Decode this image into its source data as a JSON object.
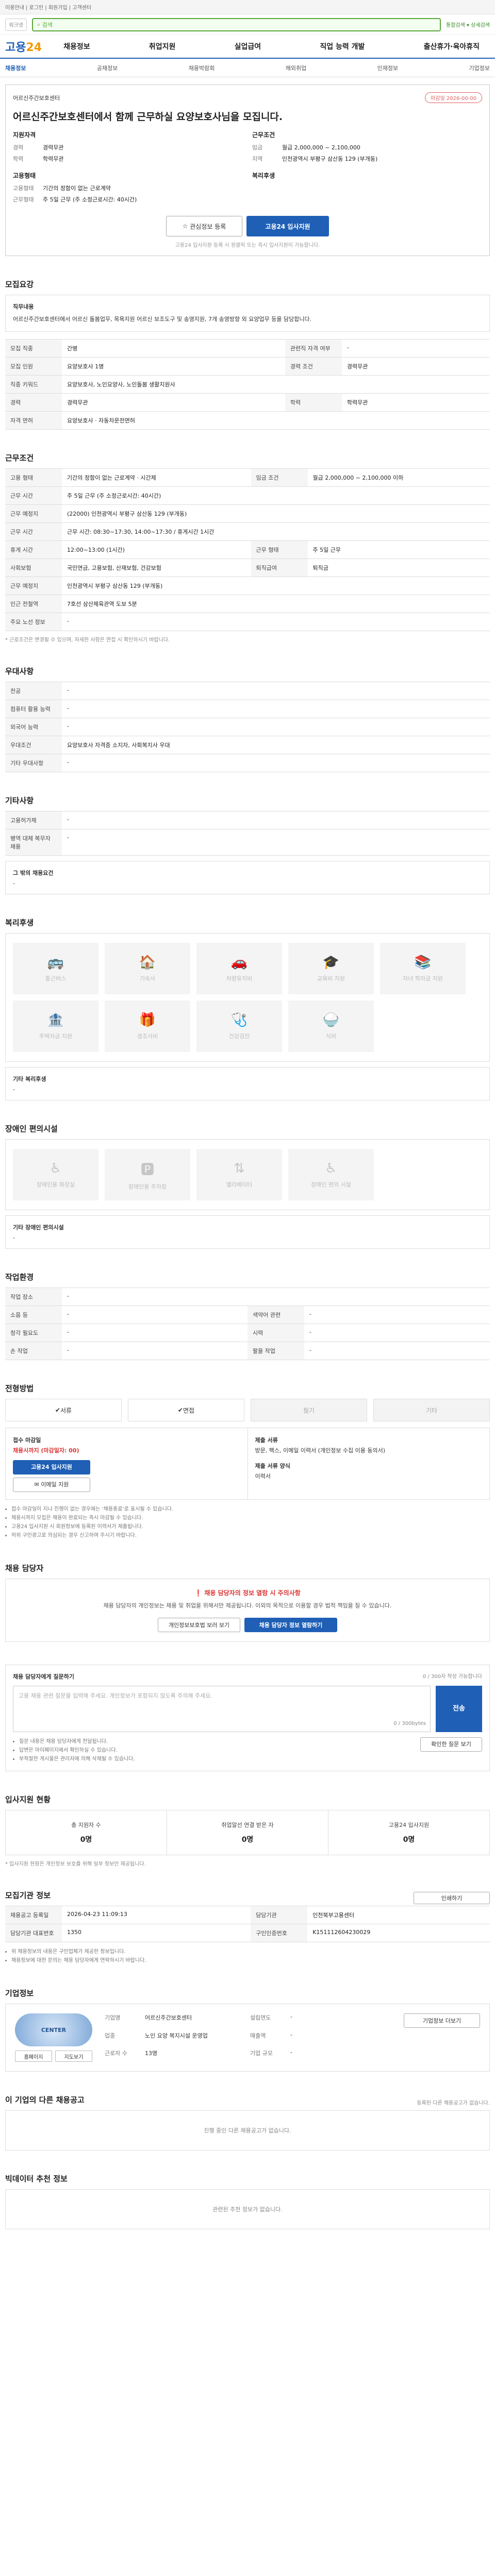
{
  "topbar": {
    "text": "이용안내 | 로그인 | 회원가입 | 고객센터"
  },
  "search": {
    "logo": "워크넷",
    "placeholder": "검색",
    "right": "통합검색 ▾ 상세검색"
  },
  "gnb": {
    "logo_main": "고용",
    "logo_sub": "24",
    "menu": [
      "채용정보",
      "취업지원",
      "실업급여",
      "직업 능력 개발",
      "출산휴가·육아휴직"
    ]
  },
  "subnav": {
    "items": [
      "채용정보",
      "공채정보",
      "채용박람회",
      "해외취업",
      "인재정보",
      "기업정보"
    ],
    "active_index": 0
  },
  "job": {
    "company": "어르신주간보호센터",
    "tag": "마감일 2026-00-00",
    "title": "어르신주간보호센터에서 함께 근무하실 요양보호사님을 모집니다.",
    "left_heading": "지원자격",
    "left": [
      {
        "k": "경력",
        "v": "경력무관"
      },
      {
        "k": "학력",
        "v": "학력무관"
      }
    ],
    "left2_heading": "고용형태",
    "left2": [
      {
        "k": "고용형태",
        "v": "기간의 정함이 없는 근로계약"
      },
      {
        "k": "근무형태",
        "v": "주 5일 근무 (주 소정근로시간: 40시간)"
      }
    ],
    "right_heading": "근무조건",
    "right": [
      {
        "k": "임금",
        "v": "월급 2,000,000 ~ 2,100,000"
      },
      {
        "k": "지역",
        "v": "인천광역시 부평구 삼산동 129 (부개동)"
      }
    ],
    "right2_heading": "복리후생",
    "btn_interest": "관심정보 등록",
    "btn_apply": "고용24 입사지원",
    "note": "고용24 입사지원 등록 시 원클릭 또는 즉시 입사지원이 가능합니다."
  },
  "recruit": {
    "title": "모집요강",
    "box_title": "직무내용",
    "box_text": "어르신주간보호센터에서 어르신 돌봄업무, 목욕지원 어르신 보조도구 및 송영지원, 7개 송영방향 외 요양업무 등을 담당합니다.",
    "rows": [
      [
        "모집 직종",
        "간병",
        "관련직 자격 여부",
        "-"
      ],
      [
        "모집 인원",
        "요양보호사 1명",
        "경력 조건",
        "경력무관"
      ],
      [
        "직종 키워드",
        "요양보호사, 노인요양사, 노인돌봄 생활지원사",
        "",
        ""
      ],
      [
        "경력",
        "경력무관",
        "학력",
        "학력무관"
      ],
      [
        "자격 면허",
        "요양보호사 · 자동차운전면허",
        "",
        ""
      ]
    ]
  },
  "conditions": {
    "title": "근무조건",
    "rows": [
      [
        "고용 형태",
        "기간의 정함이 없는 근로계약 · 시간제",
        "임금 조건",
        "월급 2,000,000 ~ 2,100,000 이하"
      ],
      [
        "근무 시간",
        "주 5일 근무 (주 소정근로시간: 40시간)",
        "",
        ""
      ],
      [
        "근무 예정지",
        "(22000) 인천광역시 부평구 삼산동 129 (부개동)",
        "",
        ""
      ],
      [
        "근무 시간",
        "근무 시간: 08:30~17:30, 14:00~17:30 / 휴게시간 1시간",
        "",
        ""
      ],
      [
        "휴게 시간",
        "12:00~13:00 (1시간)",
        "근무 형태",
        "주 5일 근무"
      ],
      [
        "사회보험",
        "국민연금, 고용보험, 산재보험, 건강보험",
        "퇴직급여",
        "퇴직금"
      ],
      [
        "근무 예정지",
        "인천광역시 부평구 삼산동 129 (부개동)",
        "",
        ""
      ],
      [
        "인근 전철역",
        "7호선 삼산체육관역 도보 5분",
        "",
        ""
      ],
      [
        "주요 노선 정보",
        "-",
        "",
        ""
      ]
    ],
    "note": "* 근로조건은 변경될 수 있으며, 자세한 사항은 면접 시 확인하시기 바랍니다."
  },
  "prefer": {
    "title": "우대사항",
    "rows": [
      [
        "전공",
        "-"
      ],
      [
        "컴퓨터 활용 능력",
        "-"
      ],
      [
        "외국어 능력",
        "-"
      ],
      [
        "우대조건",
        "요양보호사 자격증 소지자, 사회복지사 우대"
      ],
      [
        "기타 우대사항",
        "-"
      ]
    ]
  },
  "other": {
    "title": "기타사항",
    "rows": [
      [
        "고용허가제",
        "-"
      ],
      [
        "병역 대체 복무자 채용",
        "-"
      ]
    ],
    "detail_label": "그 밖의 채용요건",
    "detail_value": "-"
  },
  "welfare": {
    "title": "복리후생",
    "items": [
      "통근버스",
      "기숙사",
      "차량유지비",
      "교육비 지원",
      "자녀 학자금 지원",
      "주택자금 지원",
      "경조사비",
      "건강검진",
      "식비"
    ],
    "extra_label": "기타 복리후생",
    "extra_value": "-"
  },
  "disability": {
    "title": "장애인 편의시설",
    "items": [
      "장애인용 화장실",
      "장애인용 주차장",
      "엘리베이터",
      "장애인 편의 시설"
    ],
    "extra_label": "기타 장애인 편의시설",
    "extra_value": "-"
  },
  "env": {
    "title": "작업환경",
    "rows": [
      [
        "작업 장소",
        "-",
        "",
        ""
      ],
      [
        "소음 등",
        "-",
        "색약어 관련",
        "-"
      ],
      [
        "청각 필요도",
        "-",
        "시력",
        "-"
      ],
      [
        "손 작업",
        "-",
        "팔을 작업",
        "-"
      ]
    ]
  },
  "method": {
    "title": "전형방법",
    "tabs": [
      {
        "label": "서류",
        "on": true
      },
      {
        "label": "면접",
        "on": true
      },
      {
        "label": "필기",
        "on": false
      },
      {
        "label": "기타",
        "on": false
      }
    ],
    "apply_title": "접수 마감일",
    "apply_date": "채용시까지 (마감일자: 00)",
    "apply_btn": "고용24 입사지원",
    "email_btn": "이메일 지원",
    "docs_title": "제출 서류",
    "docs_text": "방문, 팩스, 이메일 이력서 (개인정보 수집 이용 동의서)",
    "etc_title": "제출 서류 양식",
    "etc_text": "이력서",
    "notices": [
      "접수 마감일이 지나 진행이 없는 경우에는 ‘채용종료’로 표시될 수 있습니다.",
      "채용시까지 모집은 채용이 완료되는 즉시 마감될 수 있습니다.",
      "고용24 입사지원 시 회원정보에 등록된 이력서가 제출됩니다.",
      "허위 구인광고로 의심되는 경우 신고하여 주시기 바랍니다."
    ]
  },
  "manager": {
    "title": "채용 담당자",
    "alert_title": "채용 담당자의 정보 열람 시 주의사항",
    "alert_text": "채용 담당자의 개인정보는 채용 및 취업을 위해서만 제공됩니다. 이외의 목적으로 이용할 경우 법적 책임을 질 수 있습니다.",
    "btn_policy": "개인정보보호법 보러 보기",
    "btn_view": "채용 담당자 정보 열람하기"
  },
  "inquiry": {
    "title": "채용 담당자에게 질문하기",
    "right_note": "0 / 300자 작성 가능합니다",
    "placeholder": "고용 채용 관련 질문을 입력해 주세요. 개인정보가 포함되지 않도록 주의해 주세요.",
    "count": "0 / 300bytes",
    "send": "전송",
    "notes": [
      "질문 내용은 채용 담당자에게 전달됩니다.",
      "답변은 마이페이지에서 확인하실 수 있습니다.",
      "부적절한 게시물은 관리자에 의해 삭제될 수 있습니다."
    ],
    "check_btn": "확인한 질문 보기"
  },
  "stats": {
    "title": "입사지원 현황",
    "items": [
      {
        "label": "총 지원자 수",
        "num": "0명"
      },
      {
        "label": "취업알선 연결 받은 자",
        "num": "0명"
      },
      {
        "label": "고용24 입사지원",
        "num": "0명"
      }
    ],
    "note": "* 입사지원 현황은 개인정보 보호를 위해 일부 정보만 제공됩니다."
  },
  "agency": {
    "title": "모집기관 정보",
    "print_btn": "인쇄하기",
    "rows": [
      [
        "채용공고 등록일",
        "2026-04-23 11:09:13",
        "담당기관",
        "인천북부고용센터"
      ],
      [
        "담당기관 대표번호",
        "1350",
        "구인인증번호",
        "K151112604230029"
      ]
    ],
    "notes": [
      "위 채용정보의 내용은 구인업체가 제공한 정보입니다.",
      "채용정보에 대한 문의는 채용 담당자에게 연락하시기 바랍니다."
    ]
  },
  "company": {
    "title": "기업정보",
    "logo_text": "CENTER",
    "btn_home": "홈페이지",
    "btn_map": "지도보기",
    "detail_btn": "기업정보 더보기",
    "rows": [
      [
        "기업명",
        "어르신주간보호센터",
        "설립연도",
        "-"
      ],
      [
        "업종",
        "노인 요양 복지시설 운영업",
        "매출액",
        "-"
      ],
      [
        "근로자 수",
        "13명",
        "기업 규모",
        "-"
      ]
    ]
  },
  "other_jobs": {
    "title": "이 기업의 다른 채용공고",
    "right": "등록된 다른 채용공고가 없습니다.",
    "empty": "진행 중인 다른 채용공고가 없습니다."
  },
  "recommended": {
    "title": "빅데이터 추천 정보",
    "empty": "관련된 추천 정보가 없습니다."
  }
}
